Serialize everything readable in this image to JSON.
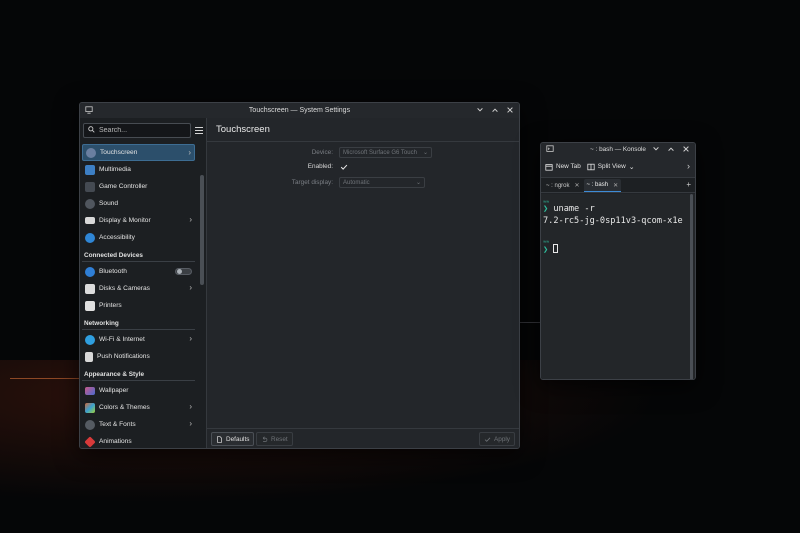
{
  "settings_window": {
    "title": "Touchscreen — System Settings",
    "search_placeholder": "Search...",
    "page_title": "Touchscreen",
    "sidebar": {
      "items_top": [
        {
          "label": "Touchscreen",
          "icon": "touchscreen-icon",
          "color": "#6a7fa0",
          "active": true,
          "chevron": true
        },
        {
          "label": "Multimedia",
          "icon": "multimedia-icon",
          "color": "#3d7fc4",
          "chevron": false
        },
        {
          "label": "Game Controller",
          "icon": "game-controller-icon",
          "color": "#444a52",
          "chevron": false
        },
        {
          "label": "Sound",
          "icon": "sound-icon",
          "color": "#50565e",
          "chevron": false
        },
        {
          "label": "Display & Monitor",
          "icon": "display-icon",
          "color": "#d8d8d8",
          "chevron": true
        },
        {
          "label": "Accessibility",
          "icon": "accessibility-icon",
          "color": "#2f86d6",
          "chevron": false
        }
      ],
      "section_connected": "Connected Devices",
      "items_connected": [
        {
          "label": "Bluetooth",
          "icon": "bluetooth-icon",
          "color": "#2f7fd6",
          "toggle": true
        },
        {
          "label": "Disks & Cameras",
          "icon": "disks-cameras-icon",
          "color": "#dcdcdc",
          "chevron": true
        },
        {
          "label": "Printers",
          "icon": "printer-icon",
          "color": "#e0e0e0",
          "chevron": false
        }
      ],
      "section_networking": "Networking",
      "items_networking": [
        {
          "label": "Wi-Fi & Internet",
          "icon": "wifi-globe-icon",
          "color": "#2f9fe0",
          "chevron": true
        },
        {
          "label": "Push Notifications",
          "icon": "push-notifications-icon",
          "color": "#d8d8d8",
          "chevron": false
        }
      ],
      "section_appearance": "Appearance & Style",
      "items_appearance": [
        {
          "label": "Wallpaper",
          "icon": "wallpaper-icon",
          "color": "#c85a8a",
          "chevron": false
        },
        {
          "label": "Colors & Themes",
          "icon": "colors-themes-icon",
          "color": "#d06a3a",
          "chevron": true
        },
        {
          "label": "Text & Fonts",
          "icon": "text-fonts-icon",
          "color": "#555b62",
          "chevron": true
        },
        {
          "label": "Animations",
          "icon": "animations-icon",
          "color": "#d83a3a",
          "chevron": false
        }
      ]
    },
    "form": {
      "device_label": "Device:",
      "device_value": "Microsoft Surface G6 Touch",
      "enabled_label": "Enabled:",
      "enabled_checked": true,
      "target_label": "Target display:",
      "target_value": "Automatic"
    },
    "footer": {
      "defaults": "Defaults",
      "reset": "Reset",
      "apply": "Apply"
    }
  },
  "konsole_window": {
    "title": "~ : bash — Konsole",
    "toolbar": {
      "new_tab": "New Tab",
      "split_view": "Split View"
    },
    "tabs": [
      {
        "label": "~ : ngrok",
        "active": false
      },
      {
        "label": "~ : bash",
        "active": true
      }
    ],
    "terminal": {
      "command": "uname -r",
      "output": "7.2-rc5-jg-0sp11v3-qcom-x1e"
    }
  },
  "colors": {
    "accent": "#3d8bd6",
    "prompt": "#2fbf9f",
    "window_bg": "#1f2226"
  }
}
